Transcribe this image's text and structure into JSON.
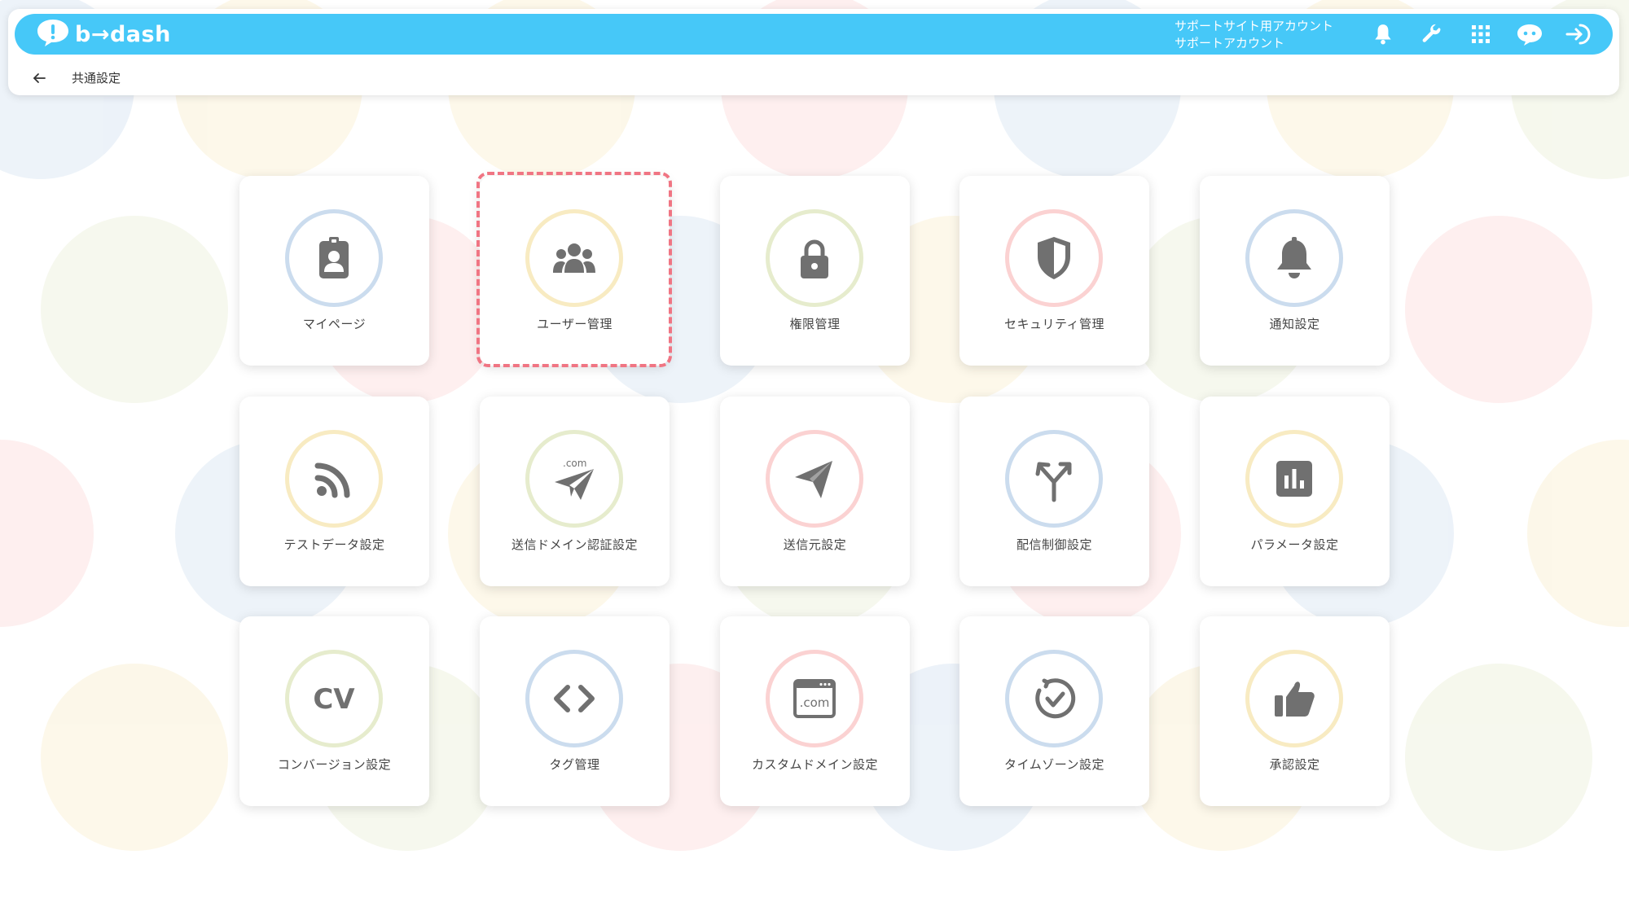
{
  "colors": {
    "header_bar": "#46c8f8",
    "icon_gray": "#707070",
    "highlight": "#f07583",
    "ring_blue": "#cbdcee",
    "ring_yellow": "#f8ebc2",
    "ring_green": "#e6eccd",
    "ring_pink": "#fbd2d2"
  },
  "header": {
    "logo_text": "b→dash",
    "account_line1": "サポートサイト用アカウント",
    "account_line2": "サポートアカウント",
    "icons": [
      "bell-icon",
      "wrench-icon",
      "apps-grid-icon",
      "chat-bot-icon",
      "logout-icon"
    ]
  },
  "breadcrumb": {
    "back_icon": "arrow-left-icon",
    "title": "共通設定"
  },
  "cards": [
    {
      "label": "マイページ",
      "icon": "id-badge-icon"
    },
    {
      "label": "ユーザー管理",
      "icon": "users-icon",
      "highlighted": true
    },
    {
      "label": "権限管理",
      "icon": "lock-icon"
    },
    {
      "label": "セキュリティ管理",
      "icon": "shield-icon"
    },
    {
      "label": "通知設定",
      "icon": "bell-icon"
    },
    {
      "label": "テストデータ設定",
      "icon": "rss-icon"
    },
    {
      "label": "送信ドメイン認証設定",
      "icon": "paper-plane-com-icon"
    },
    {
      "label": "送信元設定",
      "icon": "send-icon"
    },
    {
      "label": "配信制御設定",
      "icon": "split-arrows-icon"
    },
    {
      "label": "パラメータ設定",
      "icon": "bar-chart-icon"
    },
    {
      "label": "コンバージョン設定",
      "icon": "cv-icon"
    },
    {
      "label": "タグ管理",
      "icon": "code-icon"
    },
    {
      "label": "カスタムドメイン設定",
      "icon": "browser-com-icon"
    },
    {
      "label": "タイムゾーン設定",
      "icon": "clock-icon"
    },
    {
      "label": "承認設定",
      "icon": "thumbs-up-icon"
    }
  ],
  "icon_text": {
    "cv": "CV",
    "com": ".com"
  }
}
